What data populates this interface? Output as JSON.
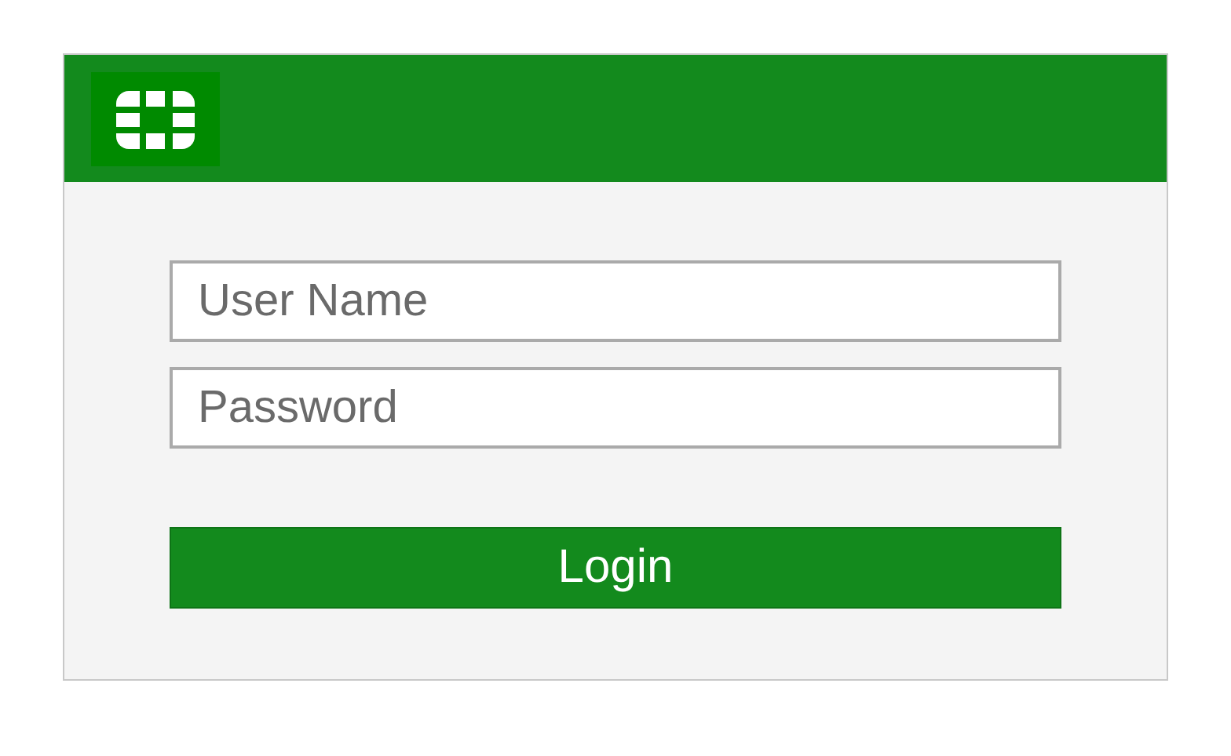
{
  "form": {
    "username": {
      "placeholder": "User Name"
    },
    "password": {
      "placeholder": "Password"
    },
    "submit": "Login"
  }
}
